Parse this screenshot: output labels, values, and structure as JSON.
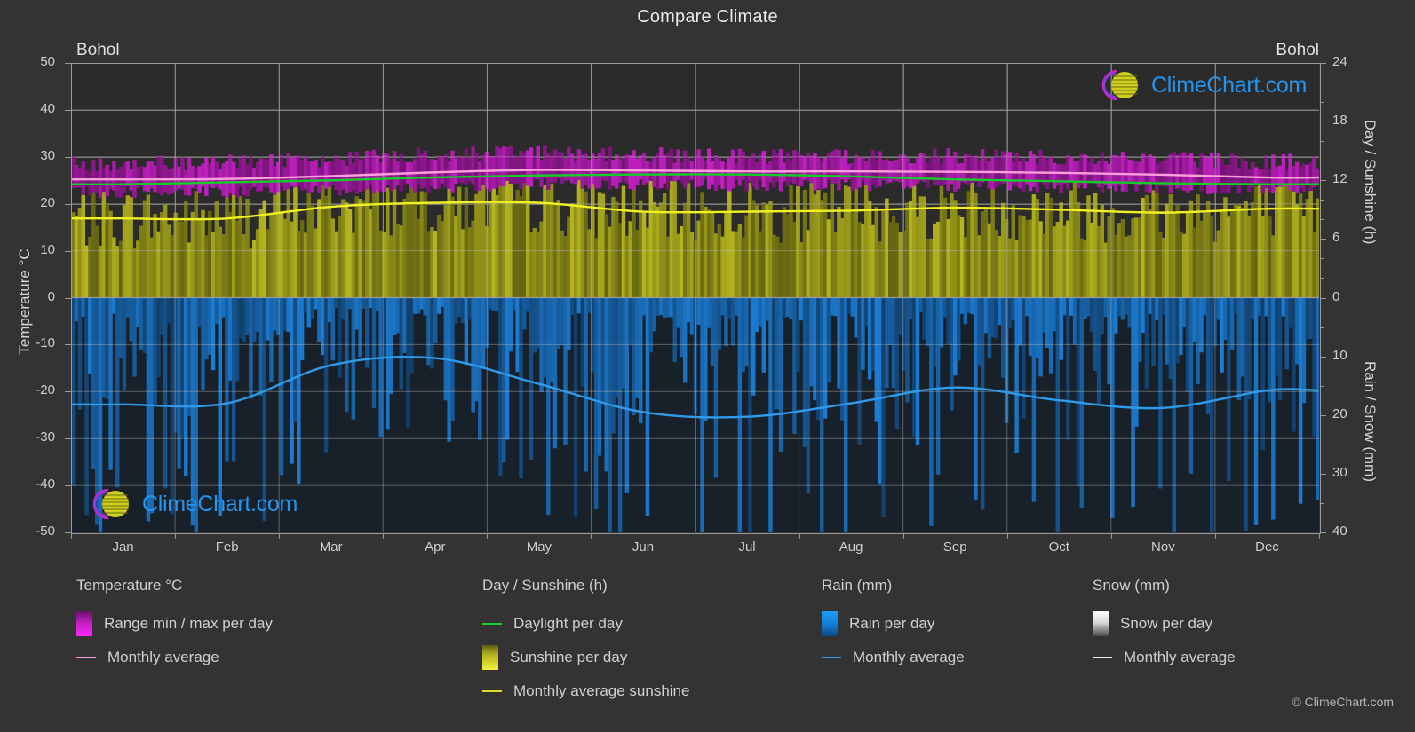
{
  "title": "Compare Climate",
  "location_left": "Bohol",
  "location_right": "Bohol",
  "copyright": "© ClimeChart.com",
  "watermark_text": "ClimeChart.com",
  "axes": {
    "left_title": "Temperature °C",
    "right_title_top": "Day / Sunshine (h)",
    "right_title_bottom": "Rain / Snow (mm)",
    "left_ticks": [
      "50",
      "40",
      "30",
      "20",
      "10",
      "0",
      "-10",
      "-20",
      "-30",
      "-40",
      "-50"
    ],
    "right_ticks_top": [
      "24",
      "18",
      "12",
      "6",
      "0"
    ],
    "right_ticks_bottom": [
      "10",
      "20",
      "30",
      "40"
    ],
    "x_ticks": [
      "Jan",
      "Feb",
      "Mar",
      "Apr",
      "May",
      "Jun",
      "Jul",
      "Aug",
      "Sep",
      "Oct",
      "Nov",
      "Dec"
    ]
  },
  "legend": {
    "temperature": {
      "heading": "Temperature °C",
      "items": [
        {
          "label": "Range min / max per day",
          "kind": "swatch",
          "color": "#cc22cc"
        },
        {
          "label": "Monthly average",
          "kind": "line",
          "color": "#ff9edd"
        }
      ]
    },
    "day_sunshine": {
      "heading": "Day / Sunshine (h)",
      "items": [
        {
          "label": "Daylight per day",
          "kind": "line",
          "color": "#16cc28"
        },
        {
          "label": "Sunshine per day",
          "kind": "swatch",
          "color": "#e8e82e"
        },
        {
          "label": "Monthly average sunshine",
          "kind": "line",
          "color": "#f2f223"
        }
      ]
    },
    "rain": {
      "heading": "Rain (mm)",
      "items": [
        {
          "label": "Rain per day",
          "kind": "swatch",
          "color": "#1184e0"
        },
        {
          "label": "Monthly average",
          "kind": "line",
          "color": "#2f9bea"
        }
      ]
    },
    "snow": {
      "heading": "Snow (mm)",
      "items": [
        {
          "label": "Snow per day",
          "kind": "swatch",
          "color": "#f0f0f0"
        },
        {
          "label": "Monthly average",
          "kind": "line",
          "color": "#e8e8e8"
        }
      ]
    }
  },
  "colors": {
    "background": "#333333",
    "plot_background": "#2b2b2b",
    "grid": "#8d8d8d",
    "temp_range": "#c020c0",
    "temp_avg": "#ff9edd",
    "daylight": "#16cc28",
    "sunshine_fill": "#b5b520",
    "sunshine_avg": "#f2f223",
    "rain_fill": "#1170c0",
    "rain_avg": "#2f9bea",
    "text": "#cfcfcf",
    "brand_blue": "#2196f3",
    "brand_magenta": "#c927c9",
    "brand_yellow": "#d4d41e"
  },
  "chart_data": {
    "type": "area",
    "title": "Compare Climate",
    "subtitle": "Bohol",
    "xlabel": "",
    "ylabel": "Temperature °C",
    "grid": true,
    "legend_position": "bottom",
    "categories": [
      "Jan",
      "Feb",
      "Mar",
      "Apr",
      "May",
      "Jun",
      "Jul",
      "Aug",
      "Sep",
      "Oct",
      "Nov",
      "Dec"
    ],
    "axes": {
      "temperature_c": {
        "min": -50,
        "max": 50,
        "step": 10
      },
      "day_sunshine_h": {
        "min": 0,
        "max": 24,
        "step": 6
      },
      "rain_snow_mm": {
        "min": 0,
        "max": 40,
        "step": 10
      }
    },
    "series": [
      {
        "name": "Monthly average temperature (°C)",
        "axis": "temperature_c",
        "color": "#ff9edd",
        "values": [
          25.2,
          25.3,
          25.9,
          26.7,
          27.2,
          27.1,
          26.9,
          26.9,
          26.8,
          26.6,
          26.2,
          25.6
        ]
      },
      {
        "name": "Daily max temperature (°C)",
        "axis": "temperature_c",
        "color": "#c020c0",
        "values": [
          28.5,
          28.8,
          29.6,
          30.5,
          30.9,
          30.4,
          30.1,
          30.2,
          30.2,
          30.0,
          29.6,
          29.0
        ]
      },
      {
        "name": "Daily min temperature (°C)",
        "axis": "temperature_c",
        "color": "#c020c0",
        "values": [
          22.5,
          22.5,
          22.9,
          23.5,
          24.1,
          24.2,
          23.9,
          23.9,
          23.8,
          23.7,
          23.5,
          23.0
        ]
      },
      {
        "name": "Daylight per day (h)",
        "axis": "day_sunshine_h",
        "color": "#16cc28",
        "values": [
          11.6,
          11.8,
          12.0,
          12.3,
          12.5,
          12.6,
          12.6,
          12.4,
          12.1,
          11.9,
          11.7,
          11.6
        ]
      },
      {
        "name": "Monthly average sunshine (h)",
        "axis": "day_sunshine_h",
        "color": "#f2f223",
        "values": [
          8.1,
          8.1,
          9.3,
          9.7,
          9.7,
          8.8,
          8.8,
          8.9,
          9.2,
          9.0,
          8.7,
          9.1
        ]
      },
      {
        "name": "Monthly average rain (mm)",
        "axis": "rain_snow_mm",
        "color": "#2f9bea",
        "values": [
          18.2,
          18.0,
          11.5,
          10.3,
          14.7,
          19.5,
          20.3,
          18.0,
          15.3,
          17.5,
          18.8,
          15.8
        ]
      },
      {
        "name": "Monthly average snow (mm)",
        "axis": "rain_snow_mm",
        "color": "#e8e8e8",
        "values": [
          0,
          0,
          0,
          0,
          0,
          0,
          0,
          0,
          0,
          0,
          0,
          0
        ]
      }
    ]
  }
}
